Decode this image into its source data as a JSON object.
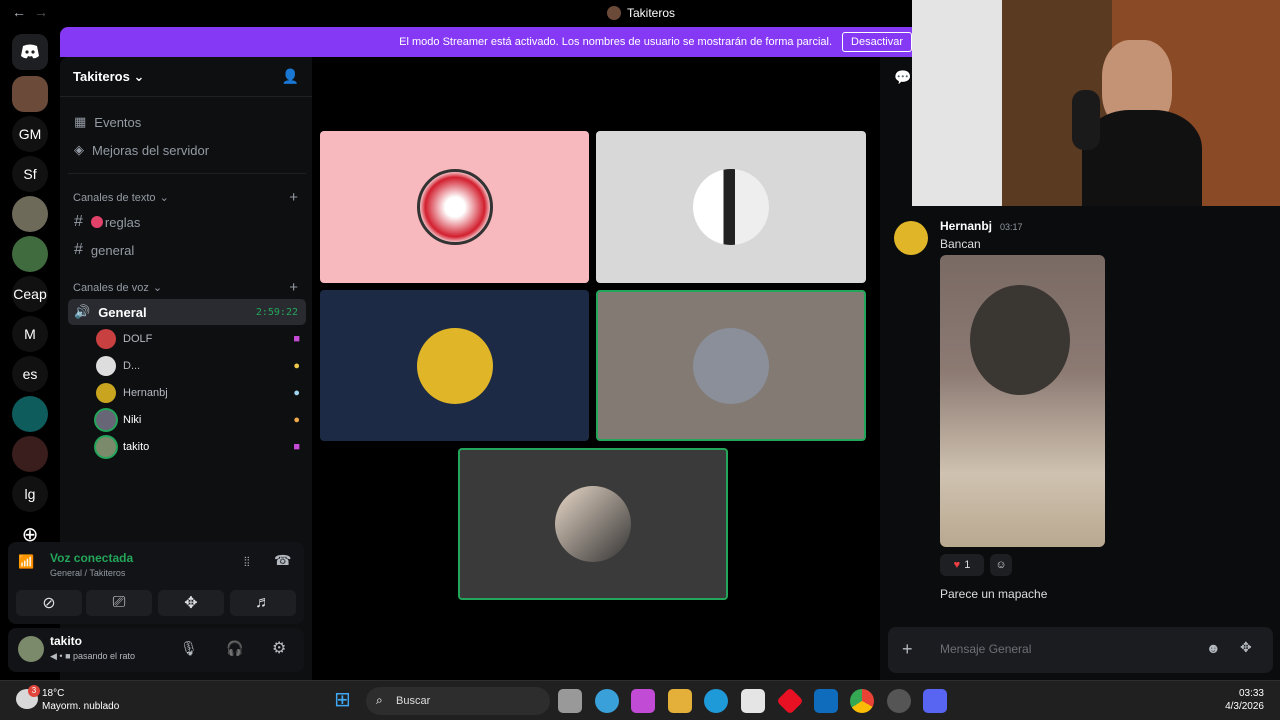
{
  "window": {
    "title": "Takiteros",
    "back": "←",
    "forward": "→"
  },
  "streamer": {
    "message": "El modo Streamer está activado. Los nombres de usuario se mostrarán de forma parcial.",
    "button": "Desactivar"
  },
  "guilds": [
    "GM",
    "Sf",
    "Ceap",
    "M",
    "es",
    "lg"
  ],
  "server": {
    "name": "Takiteros",
    "events": "Eventos",
    "boost": "Mejoras del servidor",
    "text_category": "Canales de texto",
    "text_channels": [
      "reglas",
      "general"
    ],
    "voice_category": "Canales de voz",
    "voice_channel": "General",
    "voice_timer": "2:59:22",
    "voice_users": [
      {
        "name": "DOLF",
        "color": "#b5bac1"
      },
      {
        "name": "D...",
        "color": "#b5bac1"
      },
      {
        "name": "Hernanbj",
        "color": "#b5bac1"
      },
      {
        "name": "Niki",
        "color": "#ffffff"
      },
      {
        "name": "takito",
        "color": "#ffffff"
      }
    ]
  },
  "voice_panel": {
    "status": "Voz conectada",
    "location": "General / Takiteros"
  },
  "user_panel": {
    "name": "takito",
    "status": "pasando el rato"
  },
  "chat": {
    "author": "Hernanbj",
    "time": "03:17",
    "message1": "Bancan",
    "reaction_count": "1",
    "message2": "Parece un mapache",
    "input_placeholder": "Mensaje General"
  },
  "taskbar": {
    "weather_temp": "18°C",
    "weather_desc": "Mayorm. nublado",
    "search": "Buscar",
    "time": "03:33",
    "date": "4/3/2026",
    "weather_badge": "3"
  },
  "colors": {
    "accent": "#8639f5",
    "voice_green": "#23a55a",
    "sidebar": "#0e0f11"
  }
}
